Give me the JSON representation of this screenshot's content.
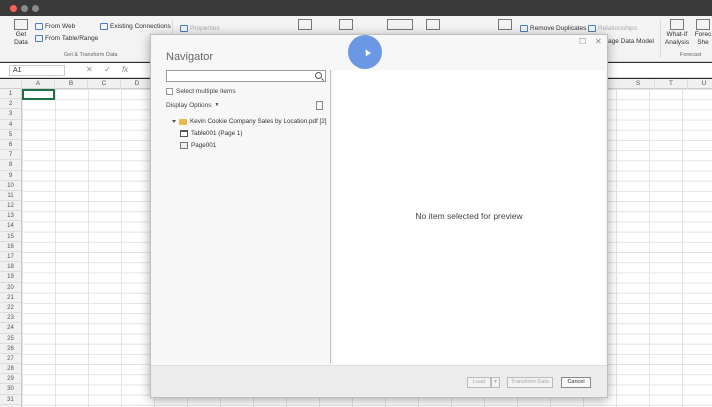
{
  "ribbon": {
    "get_data": "Get\nData",
    "from_web": "From Web",
    "from_table": "From Table/Range",
    "existing_connections": "Existing Connections",
    "properties": "Properties",
    "remove_duplicates": "Remove Duplicates",
    "relationships": "Relationships",
    "manage_data_model": "age Data Model",
    "what_if": "What-If\nAnalysis",
    "forecast_sheet": "Forec\nShe",
    "group_get_transform": "Get & Transform Data",
    "group_forecast": "Forecast"
  },
  "formula_bar": {
    "name_box": "A1",
    "fx": "fx"
  },
  "grid": {
    "columns": [
      "A",
      "B",
      "C",
      "D",
      "",
      "",
      "",
      "",
      "",
      "",
      "",
      "",
      "",
      "",
      "",
      "",
      "",
      "",
      "S",
      "T",
      "U"
    ],
    "rows": [
      "1",
      "2",
      "3",
      "4",
      "5",
      "6",
      "7",
      "8",
      "9",
      "10",
      "11",
      "12",
      "13",
      "14",
      "15",
      "16",
      "17",
      "18",
      "19",
      "20",
      "21",
      "22",
      "23",
      "24",
      "25",
      "26",
      "27",
      "28",
      "29",
      "30",
      "31"
    ]
  },
  "navigator": {
    "title": "Navigator",
    "search_placeholder": "",
    "select_multiple": "Select multiple items",
    "display_options": "Display Options",
    "tree": [
      {
        "label": "Kevin Cookie Company Sales by Location.pdf [2]",
        "icon": "folder-icon"
      },
      {
        "label": "Table001 (Page 1)",
        "icon": "table-icon"
      },
      {
        "label": "Page001",
        "icon": "page-icon"
      }
    ],
    "preview_message": "No item selected for preview",
    "buttons": {
      "load": "Load",
      "transform": "Transform Data",
      "cancel": "Cancel"
    }
  }
}
